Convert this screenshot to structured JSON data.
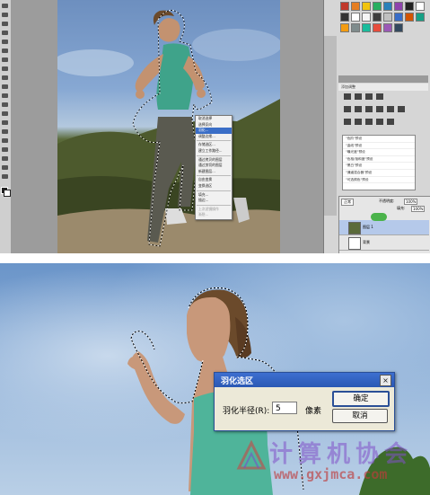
{
  "top_screenshot": {
    "context_menu": {
      "items": [
        {
          "label": "取消选择",
          "state": "normal"
        },
        {
          "label": "选择反向",
          "state": "normal"
        },
        {
          "label": "羽化...",
          "state": "highlighted"
        },
        {
          "label": "调整边缘...",
          "state": "normal"
        },
        {
          "label": "存储选区...",
          "state": "normal"
        },
        {
          "label": "建立工作路径...",
          "state": "normal"
        },
        {
          "label": "通过拷贝的图层",
          "state": "normal"
        },
        {
          "label": "通过剪切的图层",
          "state": "normal"
        },
        {
          "label": "新建图层...",
          "state": "normal"
        },
        {
          "label": "自由变换",
          "state": "normal"
        },
        {
          "label": "变换选区",
          "state": "normal"
        },
        {
          "label": "填充...",
          "state": "normal"
        },
        {
          "label": "描边...",
          "state": "normal"
        },
        {
          "label": "上次滤镜操作",
          "state": "disabled"
        },
        {
          "label": "渐隐...",
          "state": "disabled"
        }
      ]
    },
    "panels": {
      "adjustments_tab": "添加调整",
      "presets": [
        "\"色阶\"预设",
        "\"曲线\"预设",
        "\"曝光度\"预设",
        "\"色相/饱和度\"预设",
        "\"黑白\"预设",
        "\"通道混合器\"预设",
        "\"可选颜色\"预设"
      ],
      "layers": {
        "blend_mode": "正常",
        "opacity_label": "不透明度:",
        "opacity_value": "100%",
        "fill_label": "填充:",
        "fill_value": "100%",
        "rows": [
          {
            "name": "图层 1"
          },
          {
            "name": "背景"
          }
        ]
      }
    },
    "colors": {
      "highlight": "#3a6ec7",
      "panel_bg": "#d6d6d6"
    }
  },
  "bottom_screenshot": {
    "dialog": {
      "title": "羽化选区",
      "close_glyph": "×",
      "radius_label": "羽化半径(R):",
      "radius_value": "5",
      "unit": "像素",
      "ok_label": "确定",
      "cancel_label": "取消"
    },
    "watermark": {
      "text": "计算机协会",
      "url": "www.gxjmca.com"
    },
    "colors": {
      "title_bar": "#2a58b4",
      "dialog_bg": "#ece9d8"
    }
  }
}
